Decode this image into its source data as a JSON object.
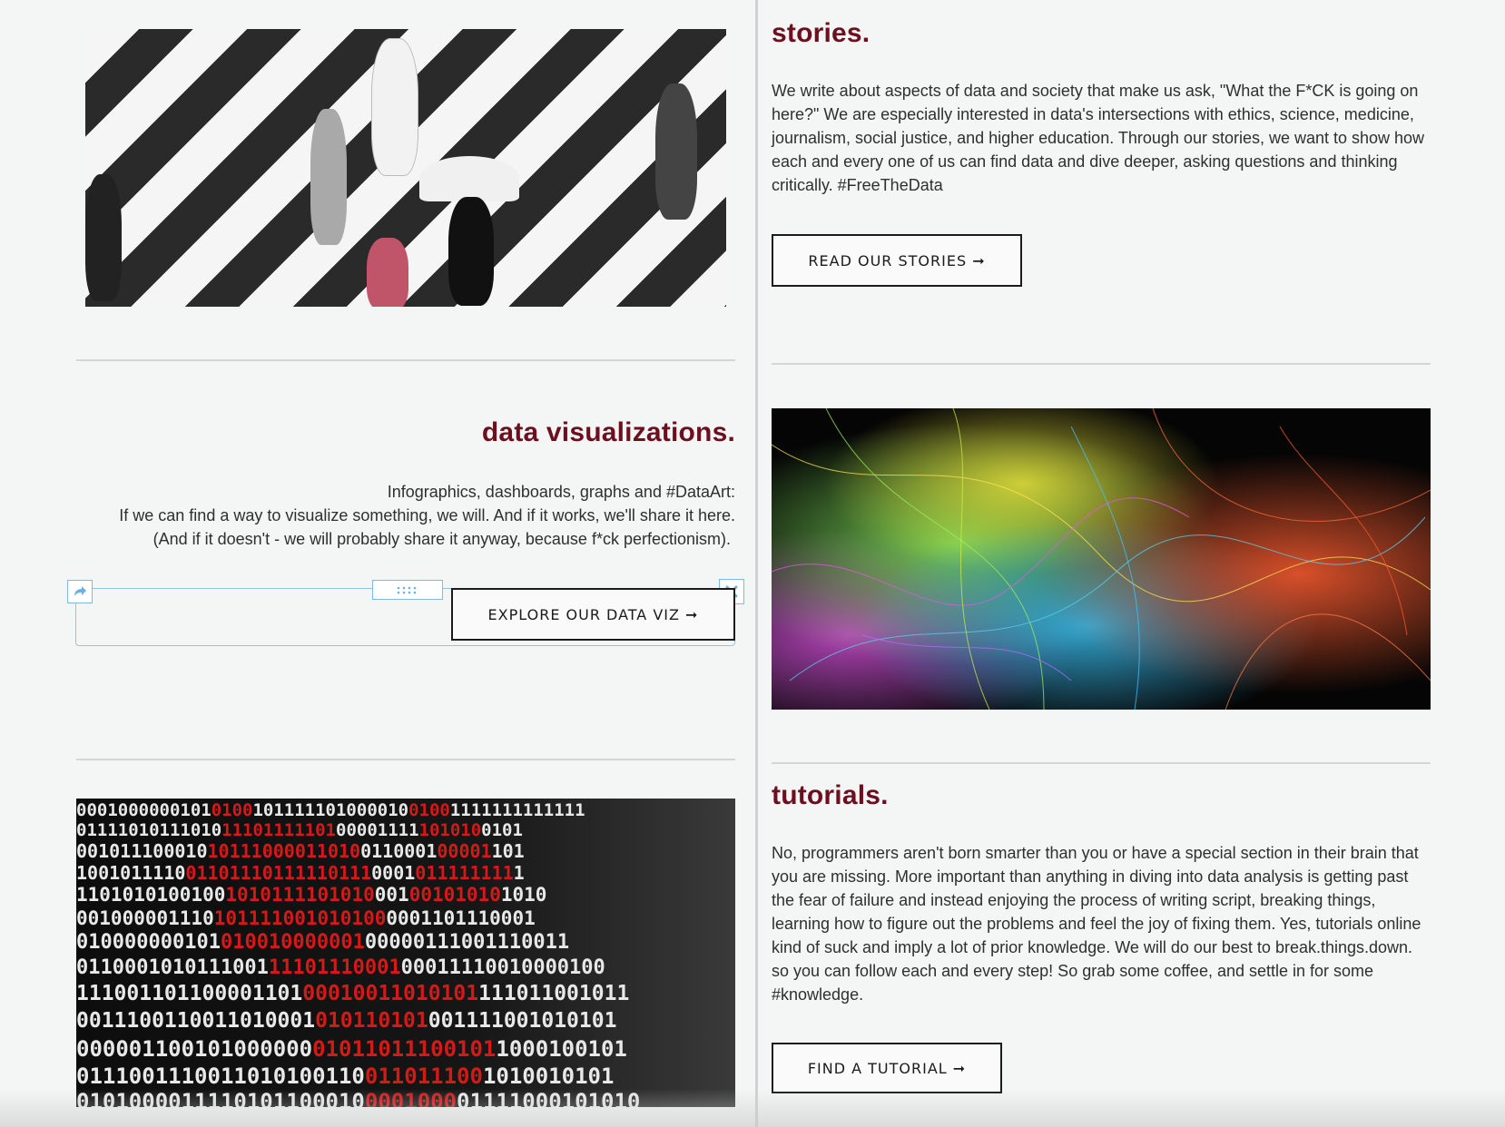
{
  "sections": {
    "stories": {
      "heading": "stories.",
      "body": "We write about aspects of data and society that make us ask, \"What the F*CK is going on here?\" We are especially interested in data's intersections with ethics, science, medicine, journalism, social justice, and higher education. Through our stories, we want to show how each and every one of us can find data and dive deeper, asking questions and thinking critically. #FreeTheData",
      "button_label": "READ OUR STORIES ➞"
    },
    "data_viz": {
      "heading": "data visualizations.",
      "line1": "Infographics, dashboards, graphs and #DataArt:",
      "line2": "If we can find a way to visualize something, we will. And if it works, we'll share it here.",
      "line3": "(And if it doesn't - we will probably share it anyway, because f*ck perfectionism).",
      "button_label": "EXPLORE OUR DATA VIZ ➞"
    },
    "tutorials": {
      "heading": "tutorials.",
      "body": "No, programmers aren't born smarter than you or have a special section in their brain that you are missing. More important than anything in diving into data analysis is getting past the fear of failure and instead enjoying the process of writing script, breaking things, learning how to figure out the problems and feel the joy of fixing them. Yes, tutorials online kind of suck and imply a lot of prior knowledge. We will do our best to break.things.down. so you can follow each and every step! So grab some coffee, and settle in for some #knowledge.",
      "button_label": "FIND A TUTORIAL ➞"
    }
  },
  "editor": {
    "link_icon": "share-arrow-icon",
    "drag_icon": "drag-handle-icon",
    "close_icon": "close-icon"
  },
  "colors": {
    "heading": "#6d0f1f",
    "background": "#f4f5f5",
    "editor_accent": "#8cc4ea"
  }
}
